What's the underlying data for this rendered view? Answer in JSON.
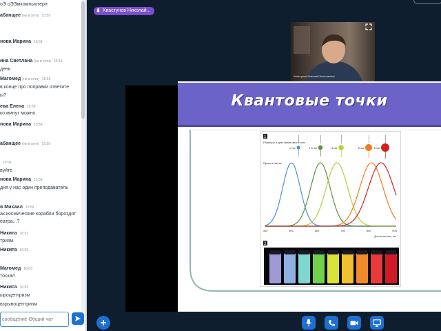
{
  "chat": {
    "lines": [
      {
        "type": "msg",
        "text": "оЭ оЭЭмкомпьютерн"
      },
      {
        "type": "author",
        "name": "абанщее",
        "status": "(не в сети)",
        "time": "15:59"
      },
      {
        "type": "author",
        "name": "нова Марина",
        "time": "15:59"
      },
      {
        "type": "author",
        "name": "ина Светлана",
        "status": "(не в сети)",
        "time": "15:59"
      },
      {
        "type": "msg",
        "text": "день"
      },
      {
        "type": "author",
        "name": "Магомед",
        "status": "(не в сети)",
        "time": "15:59"
      },
      {
        "type": "msg",
        "text": "в конце про поправки ответите"
      },
      {
        "type": "msg",
        "text": "ы?"
      },
      {
        "type": "author",
        "name": "ева Елена",
        "time": "15:59"
      },
      {
        "type": "msg",
        "text": "ко минут можно"
      },
      {
        "type": "author",
        "name": "нова Марина",
        "time": "15:59"
      },
      {
        "type": "author",
        "name": "абанщее",
        "status": "(не в сети)",
        "time": "15:59"
      },
      {
        "type": "author",
        "name": "",
        "time": "15:59"
      },
      {
        "type": "msg",
        "text": "вуйте"
      },
      {
        "type": "author",
        "name": "нова Марина",
        "time": "15:59"
      },
      {
        "type": "msg",
        "text": "дня у нас один преподаватель"
      },
      {
        "type": "author",
        "name": "в Михаил",
        "time": "15:59"
      },
      {
        "type": "msg",
        "text": "ак космические корабли бороздят"
      },
      {
        "type": "msg",
        "text": "еатра...?"
      },
      {
        "type": "author",
        "name": "Никита",
        "time": "16:03"
      },
      {
        "type": "msg",
        "text": "тризм"
      },
      {
        "type": "author",
        "name": "Никита",
        "time": "16:03"
      },
      {
        "type": "author",
        "name": "Магомед",
        "time": "16:03"
      },
      {
        "type": "msg",
        "text": "тоскал"
      },
      {
        "type": "author",
        "name": "Никита",
        "time": "16:03"
      },
      {
        "type": "msg",
        "text": "ыроцентризм"
      },
      {
        "type": "msg",
        "text": "взрывоцентризм"
      }
    ],
    "input_placeholder": "сообщение Общий чат"
  },
  "presenter": {
    "name": "Хвастунов Николай..."
  },
  "webcam": {
    "caption": "Хвастунов Николай Николаевич"
  },
  "slide": {
    "title": "Квантовые точки",
    "figure": {
      "panel1_number": "1",
      "panel2_number": "2",
      "legend_title": "Размеры и цвет квантовых точек",
      "ylabel": "Яркость света",
      "xlabel": "Длина волны, нм",
      "x_ticks": [
        "400",
        "500",
        "600",
        "700",
        "800",
        "900"
      ],
      "sizes": [
        {
          "label": "2 нм",
          "color": "#4a8fd8"
        },
        {
          "label": "2,5 нм",
          "color": "#5f8f3a"
        },
        {
          "label": "3 нм",
          "color": "#b7cf3a"
        },
        {
          "label": "5 нм",
          "color": "#f07a1a"
        },
        {
          "label": "6 нм",
          "color": "#d42020"
        }
      ],
      "vial_colors": [
        "#9d9ad6",
        "#8fb0e0",
        "#7ed8d0",
        "#6fd24a",
        "#d8e23a",
        "#f0c030",
        "#f08a2a",
        "#e83a3a",
        "#d01a28"
      ]
    }
  },
  "colors": {
    "accent": "#1f6fd1",
    "background": "#0f1e2e",
    "slide_header": "#6b63c7",
    "presenter_chip": "#7b4fc9"
  }
}
